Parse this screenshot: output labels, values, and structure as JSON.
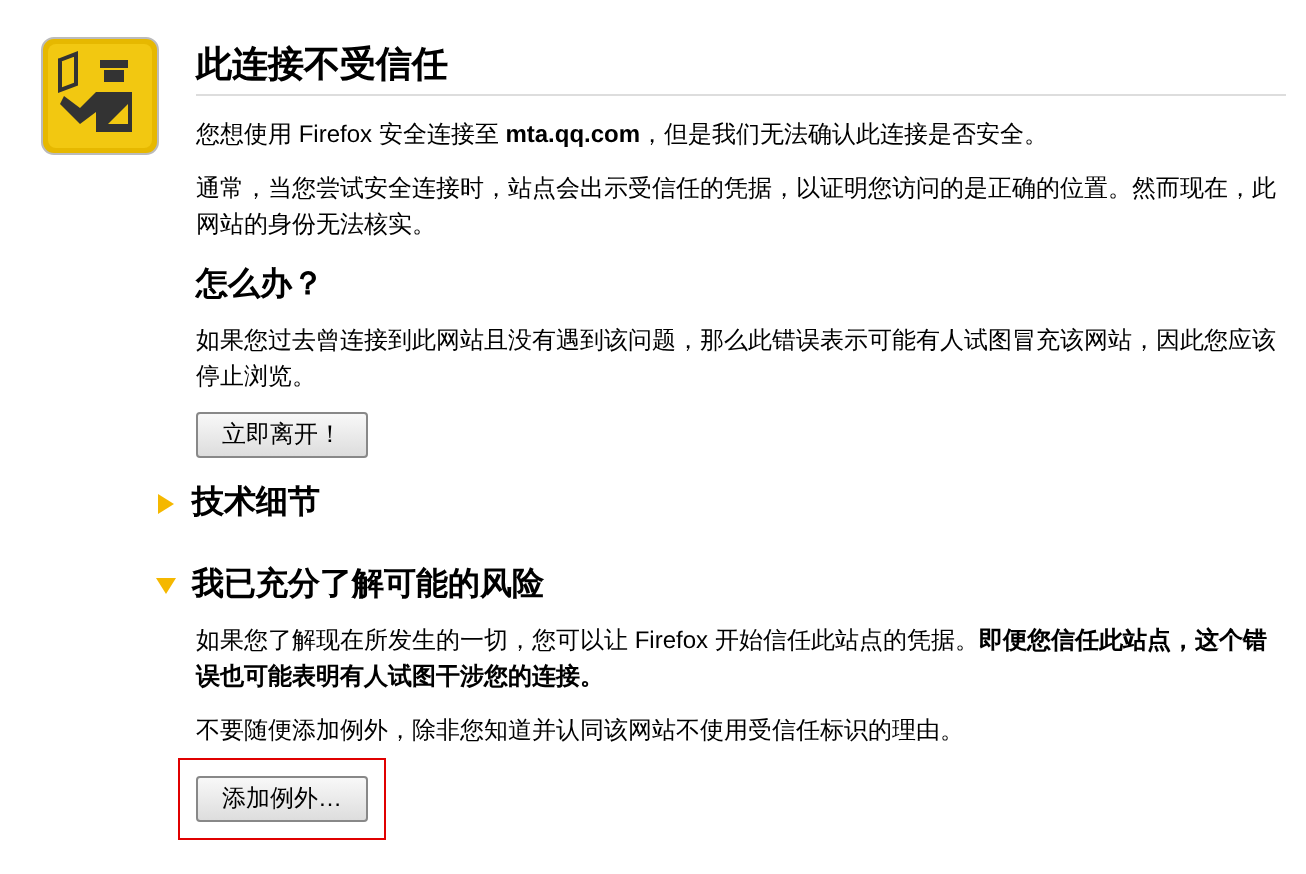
{
  "title": "此连接不受信任",
  "intro": "您想使用 Firefox 安全连接至 **mta.qq.com**，但是我们无法确认此连接是否安全。",
  "explanation": "通常，当您尝试安全连接时，站点会出示受信任的凭据，以证明您访问的是正确的位置。然而现在，此网站的身份无法核实。",
  "what_to_do": {
    "heading": "怎么办？",
    "text": "如果您过去曾连接到此网站且没有遇到该问题，那么此错误表示可能有人试图冒充该网站，因此您应该停止浏览。",
    "button": "立即离开！"
  },
  "sections": [
    {
      "heading": "技术细节",
      "expanded": false
    },
    {
      "heading": "我已充分了解可能的风险",
      "expanded": true,
      "paragraphs": [
        "如果您了解现在所发生的一切，您可以让 Firefox 开始信任此站点的凭据。**即便您信任此站点，这个错误也可能表明有人试图干涉您的连接。**",
        "不要随便添加例外，除非您知道并认同该网站不使用受信任标识的理由。"
      ],
      "button": {
        "label": "添加例外…",
        "highlighted": true
      }
    }
  ]
}
